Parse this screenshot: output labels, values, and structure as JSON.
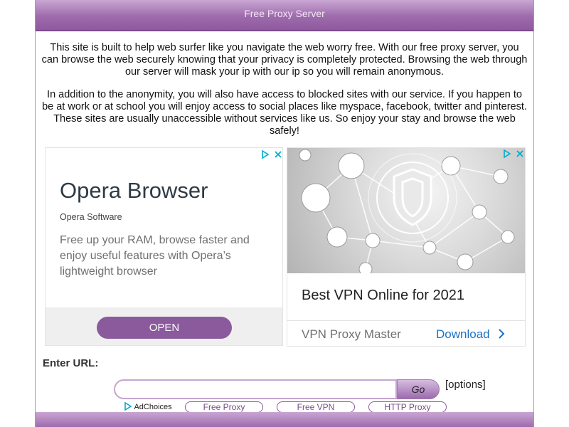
{
  "header": {
    "title": "Free Proxy Server"
  },
  "intro": {
    "paragraph_1": "This site is built to help web surfer like you navigate the web worry free. With our free proxy server, you can browse the web securely knowing that your privacy is completely protected. Browsing the web through our server will mask your ip with our ip so you will remain anonymous.",
    "paragraph_2": "In addition to the anonymity, you will also have access to blocked sites with our service. If you happen to be at work or at school you will enjoy access to social places like myspace, facebook, twitter and pinterest. These sites are usually unaccessible without services like us. So enjoy your stay and browse the web safely!"
  },
  "ad_left": {
    "title": "Opera Browser",
    "advertiser": "Opera Software",
    "description": "Free up your RAM, browse faster and enjoy useful features with Opera’s lightweight browser",
    "button_label": "OPEN"
  },
  "ad_right": {
    "title": "Best VPN Online for 2021",
    "advertiser": "VPN Proxy Master",
    "cta_label": "Download"
  },
  "form": {
    "enter_url_label": "Enter URL:",
    "url_value": "",
    "go_label": "Go",
    "options_label": "[options]"
  },
  "footer_links": {
    "adchoices_label": "AdChoices",
    "links": [
      "Free Proxy",
      "Free VPN",
      "HTTP Proxy"
    ]
  },
  "colors": {
    "accent": "#8b5a9c",
    "header": "#9e6bac",
    "link_blue": "#1a73c8"
  }
}
